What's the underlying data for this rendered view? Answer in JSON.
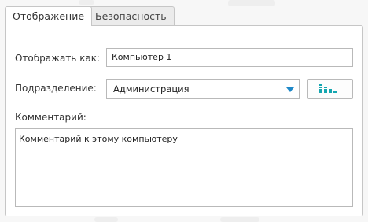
{
  "tabs": [
    {
      "label": "Отображение"
    },
    {
      "label": "Безопасность"
    }
  ],
  "form": {
    "display_as": {
      "label": "Отображать как:",
      "value": "Компьютер 1"
    },
    "department": {
      "label": "Подразделение:",
      "value": "Администрация"
    },
    "comment": {
      "label": "Комментарий:",
      "value": "Комментарий к этому компьютеру"
    }
  },
  "icons": {
    "dropdown": "chevron-down-icon",
    "tree_picker": "tree-icon"
  },
  "colors": {
    "accent": "#1e88c8",
    "tree_icon": "#14a6b0"
  }
}
